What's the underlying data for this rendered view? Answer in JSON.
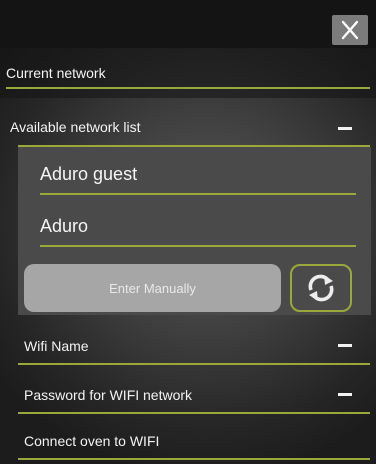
{
  "colors": {
    "accent_line": "#9aa73a",
    "top_bar": "#141414",
    "panel_bg": "#4a4a4a",
    "enter_button_bg": "#a6a6a6",
    "close_button_bg": "#7c7c7c"
  },
  "header": {
    "close_icon": "close-icon"
  },
  "current_network": {
    "label": "Current network"
  },
  "available_networks": {
    "label": "Available network list",
    "toggle_icon": "minus-icon",
    "items": [
      {
        "label": "Aduro guest"
      },
      {
        "label": "Aduro"
      }
    ],
    "enter_manually_label": "Enter Manually",
    "refresh_icon": "refresh-icon"
  },
  "wifi_name": {
    "label": "Wifi Name",
    "toggle_icon": "minus-icon"
  },
  "password": {
    "label": "Password for WIFI network",
    "toggle_icon": "minus-icon"
  },
  "connect": {
    "label": "Connect oven to WIFI"
  }
}
